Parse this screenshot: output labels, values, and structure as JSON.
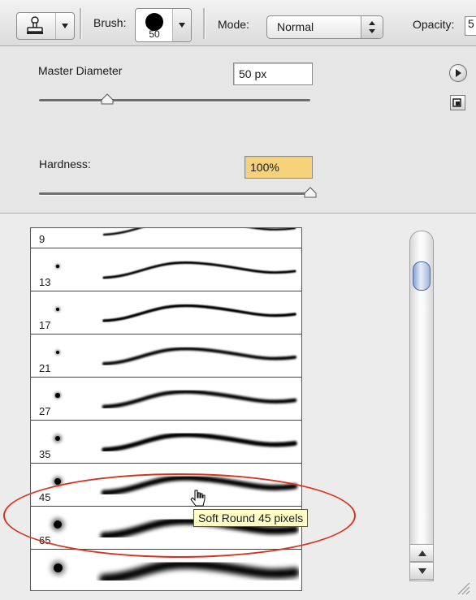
{
  "toolbar": {
    "brush_label": "Brush:",
    "brush_size": "50",
    "mode_label": "Mode:",
    "mode_value": "Normal",
    "opacity_label": "Opacity:",
    "opacity_value": "5"
  },
  "settings": {
    "master_diameter_label": "Master Diameter",
    "master_diameter_value": "50 px",
    "master_diameter_slider": 0.25,
    "hardness_label": "Hardness:",
    "hardness_value": "100%",
    "hardness_slider": 1.0,
    "hardness_highlight_color": "#f5d27a"
  },
  "brushes": [
    {
      "size": "9"
    },
    {
      "size": "13"
    },
    {
      "size": "17"
    },
    {
      "size": "21"
    },
    {
      "size": "27"
    },
    {
      "size": "35"
    },
    {
      "size": "45"
    },
    {
      "size": "65"
    },
    {
      "size": ""
    }
  ],
  "tooltip": "Soft Round 45 pixels",
  "icons": {
    "tool": "clone-stamp-icon",
    "flyout": "play-arrow-icon",
    "new_preset": "new-preset-icon",
    "cursor": "hand-cursor-icon"
  },
  "colors": {
    "annotation": "#d9321c",
    "tooltip_bg": "#ffffc6",
    "scroll_thumb": "#8aa3d0"
  }
}
